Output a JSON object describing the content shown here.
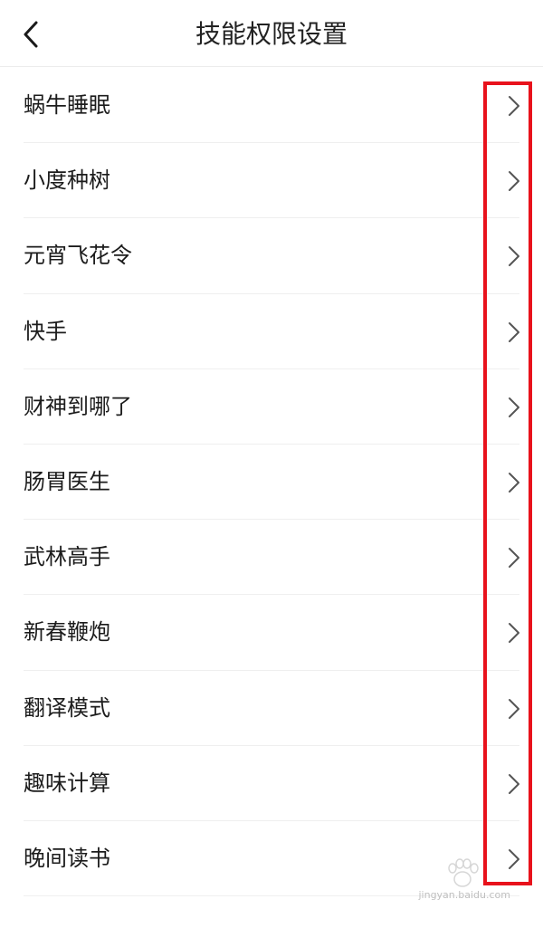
{
  "header": {
    "title": "技能权限设置"
  },
  "skills": [
    {
      "label": "蜗牛睡眠"
    },
    {
      "label": "小度种树"
    },
    {
      "label": "元宵飞花令"
    },
    {
      "label": "快手"
    },
    {
      "label": "财神到哪了"
    },
    {
      "label": "肠胃医生"
    },
    {
      "label": "武林高手"
    },
    {
      "label": "新春鞭炮"
    },
    {
      "label": "翻译模式"
    },
    {
      "label": "趣味计算"
    },
    {
      "label": "晚间读书"
    }
  ],
  "watermark": {
    "domain": "jingyan.baidu.com"
  },
  "colors": {
    "highlight": "#e8121c",
    "chevron": "#555555",
    "divider": "#efefef"
  }
}
